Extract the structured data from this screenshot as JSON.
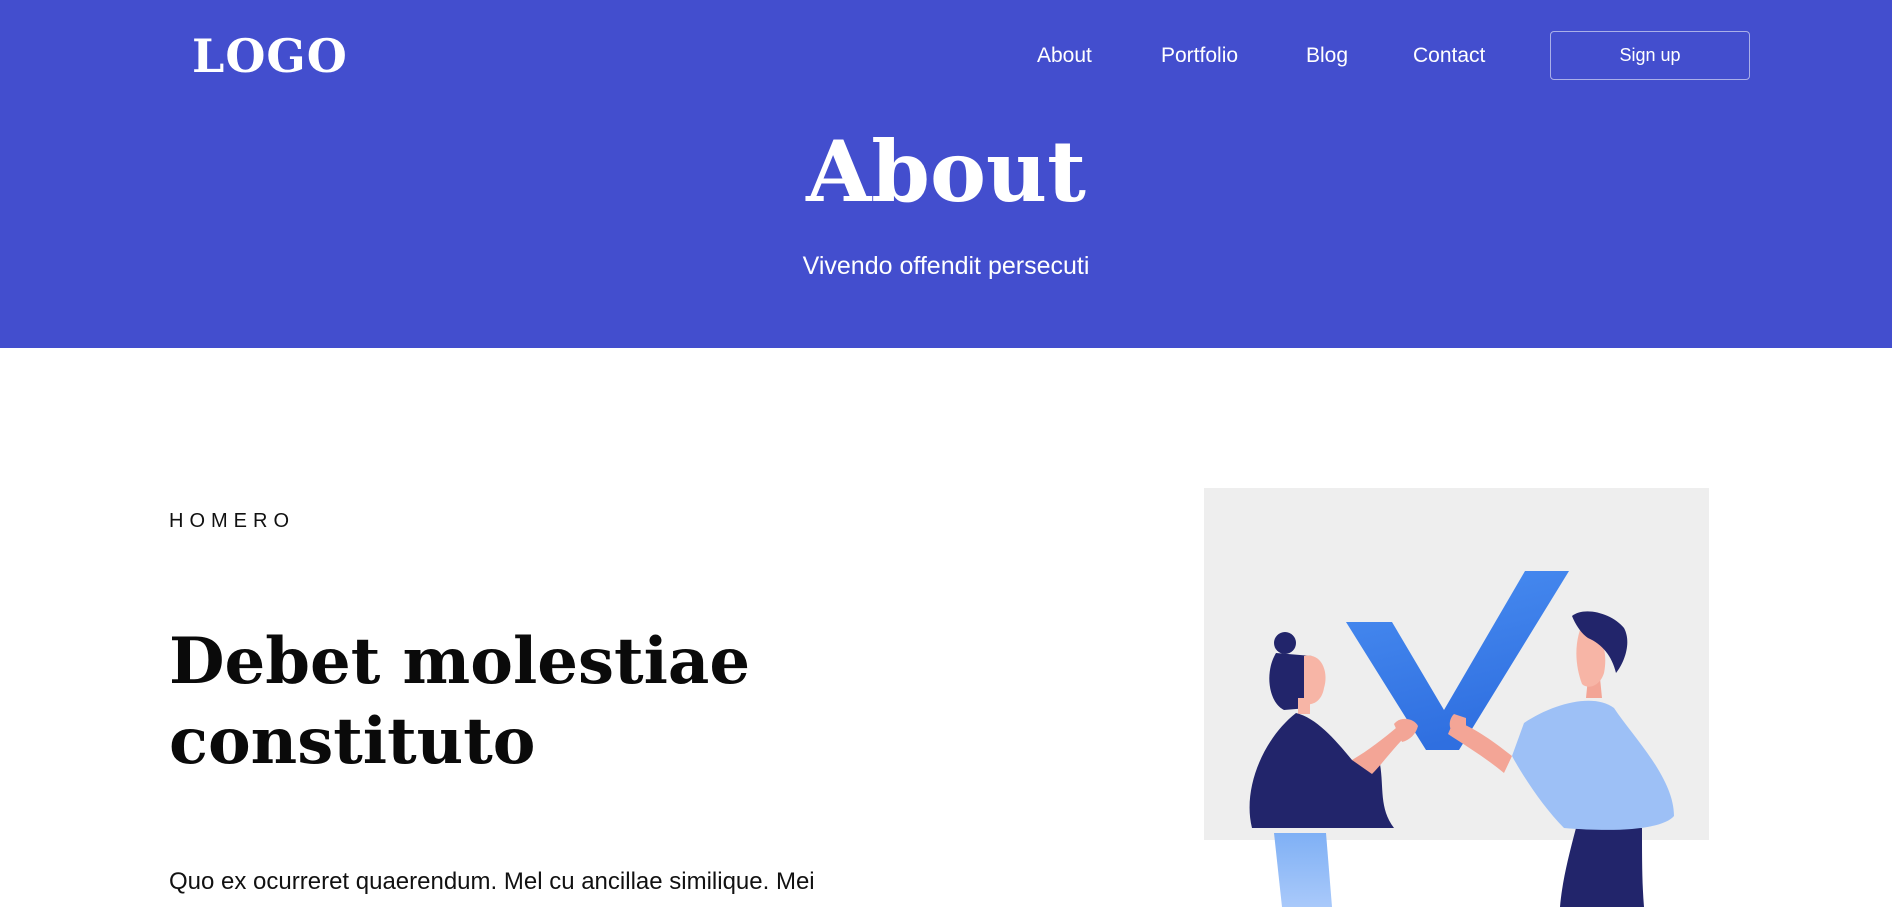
{
  "header": {
    "logo": "LOGO",
    "nav": {
      "about": "About",
      "portfolio": "Portfolio",
      "blog": "Blog",
      "contact": "Contact"
    },
    "signup_label": "Sign up"
  },
  "hero": {
    "title": "About",
    "subtitle": "Vivendo offendit persecuti"
  },
  "section": {
    "eyebrow": "HOMERO",
    "heading_line1": "Debet molestiae",
    "heading_line2": "constituto",
    "body": "Quo ex ocurreret quaerendum. Mel cu ancillae similique. Mei"
  },
  "colors": {
    "brand": "#434ece",
    "illustration_bg": "#eeeeee",
    "check_mark": "#3f86f0",
    "woman_clothes": "#22256b",
    "man_shirt": "#9dc0f6"
  },
  "illustration": {
    "icon": "check-mark-illustration"
  }
}
